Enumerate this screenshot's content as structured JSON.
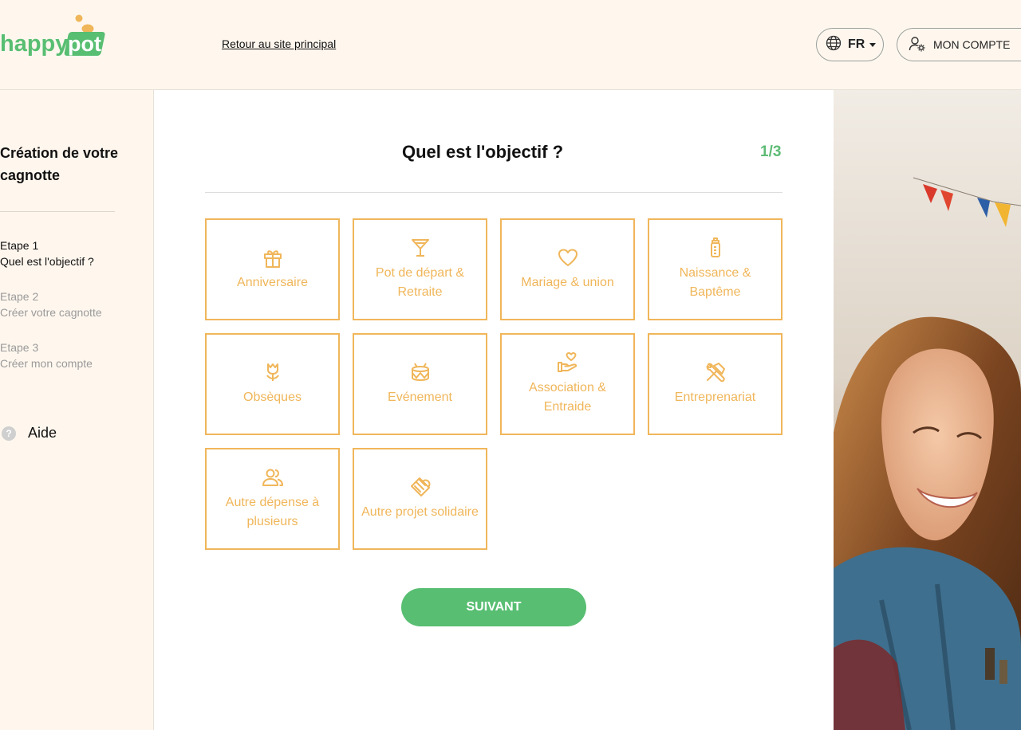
{
  "header": {
    "logo_text_happy": "happy",
    "logo_text_pot": "pot",
    "back_link": "Retour au site principal",
    "language": "FR",
    "account_label": "MON COMPTE"
  },
  "sidebar": {
    "title": "Création de votre cagnotte",
    "steps": [
      {
        "num": "Etape 1",
        "label": "Quel est l'objectif ?"
      },
      {
        "num": "Etape 2",
        "label": "Créer votre cagnotte"
      },
      {
        "num": "Etape 3",
        "label": "Créer mon compte"
      }
    ],
    "help_label": "Aide",
    "help_glyph": "?"
  },
  "main": {
    "question": "Quel est l'objectif ?",
    "step_counter": "1/3",
    "next_label": "SUIVANT",
    "categories": [
      {
        "label": "Anniversaire",
        "icon": "gift-icon"
      },
      {
        "label": "Pot de départ & Retraite",
        "icon": "cocktail-icon"
      },
      {
        "label": "Mariage & union",
        "icon": "heart-icon"
      },
      {
        "label": "Naissance & Baptême",
        "icon": "baby-bottle-icon"
      },
      {
        "label": "Obsèques",
        "icon": "tulip-icon"
      },
      {
        "label": "Evénement",
        "icon": "drum-icon"
      },
      {
        "label": "Association & Entraide",
        "icon": "hand-heart-icon"
      },
      {
        "label": "Entreprenariat",
        "icon": "tools-icon"
      },
      {
        "label": "Autre dépense à plusieurs",
        "icon": "users-icon"
      },
      {
        "label": "Autre projet solidaire",
        "icon": "handshake-icon"
      }
    ]
  },
  "colors": {
    "accent_orange": "#f0b65a",
    "accent_green": "#58be72",
    "background_cream": "#fff7ee"
  }
}
